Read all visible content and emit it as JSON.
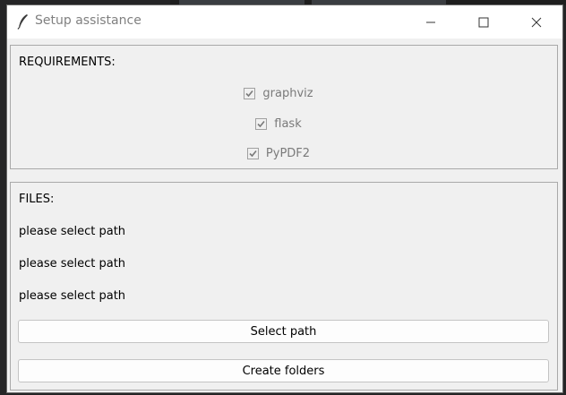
{
  "window": {
    "title": "Setup assistance"
  },
  "requirements": {
    "heading": "REQUIREMENTS:",
    "items": [
      {
        "label": "graphviz",
        "checked": true,
        "enabled": false
      },
      {
        "label": "flask",
        "checked": true,
        "enabled": false
      },
      {
        "label": "PyPDF2",
        "checked": true,
        "enabled": false
      }
    ]
  },
  "files": {
    "heading": "FILES:",
    "paths": [
      "please select path",
      "please select path",
      "please select path"
    ],
    "select_button": "Select path",
    "create_button": "Create folders"
  },
  "colors": {
    "window_bg": "#f0f0f0",
    "titlebar_bg": "#ffffff",
    "disabled_text": "#7a7a7a"
  }
}
